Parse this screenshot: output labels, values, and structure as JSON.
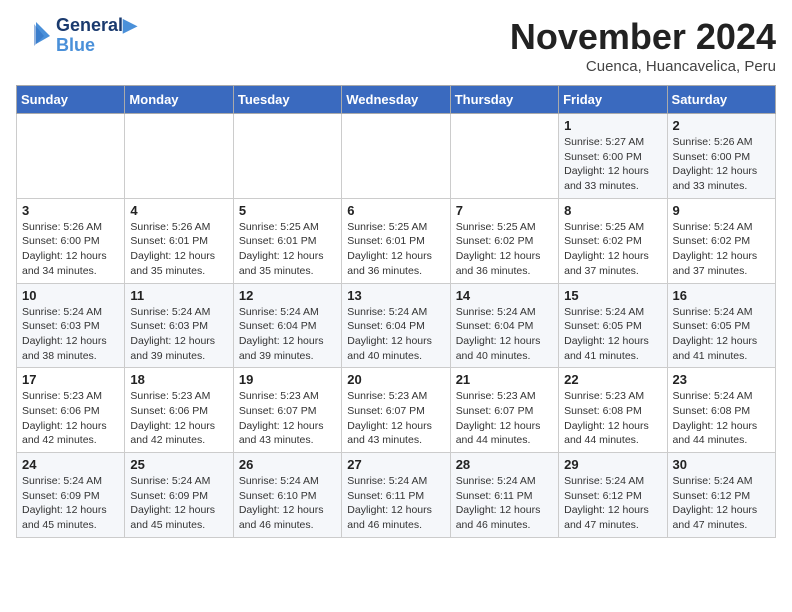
{
  "header": {
    "logo_line1": "General",
    "logo_line2": "Blue",
    "month": "November 2024",
    "location": "Cuenca, Huancavelica, Peru"
  },
  "weekdays": [
    "Sunday",
    "Monday",
    "Tuesday",
    "Wednesday",
    "Thursday",
    "Friday",
    "Saturday"
  ],
  "weeks": [
    [
      {
        "day": "",
        "info": ""
      },
      {
        "day": "",
        "info": ""
      },
      {
        "day": "",
        "info": ""
      },
      {
        "day": "",
        "info": ""
      },
      {
        "day": "",
        "info": ""
      },
      {
        "day": "1",
        "info": "Sunrise: 5:27 AM\nSunset: 6:00 PM\nDaylight: 12 hours and 33 minutes."
      },
      {
        "day": "2",
        "info": "Sunrise: 5:26 AM\nSunset: 6:00 PM\nDaylight: 12 hours and 33 minutes."
      }
    ],
    [
      {
        "day": "3",
        "info": "Sunrise: 5:26 AM\nSunset: 6:00 PM\nDaylight: 12 hours and 34 minutes."
      },
      {
        "day": "4",
        "info": "Sunrise: 5:26 AM\nSunset: 6:01 PM\nDaylight: 12 hours and 35 minutes."
      },
      {
        "day": "5",
        "info": "Sunrise: 5:25 AM\nSunset: 6:01 PM\nDaylight: 12 hours and 35 minutes."
      },
      {
        "day": "6",
        "info": "Sunrise: 5:25 AM\nSunset: 6:01 PM\nDaylight: 12 hours and 36 minutes."
      },
      {
        "day": "7",
        "info": "Sunrise: 5:25 AM\nSunset: 6:02 PM\nDaylight: 12 hours and 36 minutes."
      },
      {
        "day": "8",
        "info": "Sunrise: 5:25 AM\nSunset: 6:02 PM\nDaylight: 12 hours and 37 minutes."
      },
      {
        "day": "9",
        "info": "Sunrise: 5:24 AM\nSunset: 6:02 PM\nDaylight: 12 hours and 37 minutes."
      }
    ],
    [
      {
        "day": "10",
        "info": "Sunrise: 5:24 AM\nSunset: 6:03 PM\nDaylight: 12 hours and 38 minutes."
      },
      {
        "day": "11",
        "info": "Sunrise: 5:24 AM\nSunset: 6:03 PM\nDaylight: 12 hours and 39 minutes."
      },
      {
        "day": "12",
        "info": "Sunrise: 5:24 AM\nSunset: 6:04 PM\nDaylight: 12 hours and 39 minutes."
      },
      {
        "day": "13",
        "info": "Sunrise: 5:24 AM\nSunset: 6:04 PM\nDaylight: 12 hours and 40 minutes."
      },
      {
        "day": "14",
        "info": "Sunrise: 5:24 AM\nSunset: 6:04 PM\nDaylight: 12 hours and 40 minutes."
      },
      {
        "day": "15",
        "info": "Sunrise: 5:24 AM\nSunset: 6:05 PM\nDaylight: 12 hours and 41 minutes."
      },
      {
        "day": "16",
        "info": "Sunrise: 5:24 AM\nSunset: 6:05 PM\nDaylight: 12 hours and 41 minutes."
      }
    ],
    [
      {
        "day": "17",
        "info": "Sunrise: 5:23 AM\nSunset: 6:06 PM\nDaylight: 12 hours and 42 minutes."
      },
      {
        "day": "18",
        "info": "Sunrise: 5:23 AM\nSunset: 6:06 PM\nDaylight: 12 hours and 42 minutes."
      },
      {
        "day": "19",
        "info": "Sunrise: 5:23 AM\nSunset: 6:07 PM\nDaylight: 12 hours and 43 minutes."
      },
      {
        "day": "20",
        "info": "Sunrise: 5:23 AM\nSunset: 6:07 PM\nDaylight: 12 hours and 43 minutes."
      },
      {
        "day": "21",
        "info": "Sunrise: 5:23 AM\nSunset: 6:07 PM\nDaylight: 12 hours and 44 minutes."
      },
      {
        "day": "22",
        "info": "Sunrise: 5:23 AM\nSunset: 6:08 PM\nDaylight: 12 hours and 44 minutes."
      },
      {
        "day": "23",
        "info": "Sunrise: 5:24 AM\nSunset: 6:08 PM\nDaylight: 12 hours and 44 minutes."
      }
    ],
    [
      {
        "day": "24",
        "info": "Sunrise: 5:24 AM\nSunset: 6:09 PM\nDaylight: 12 hours and 45 minutes."
      },
      {
        "day": "25",
        "info": "Sunrise: 5:24 AM\nSunset: 6:09 PM\nDaylight: 12 hours and 45 minutes."
      },
      {
        "day": "26",
        "info": "Sunrise: 5:24 AM\nSunset: 6:10 PM\nDaylight: 12 hours and 46 minutes."
      },
      {
        "day": "27",
        "info": "Sunrise: 5:24 AM\nSunset: 6:11 PM\nDaylight: 12 hours and 46 minutes."
      },
      {
        "day": "28",
        "info": "Sunrise: 5:24 AM\nSunset: 6:11 PM\nDaylight: 12 hours and 46 minutes."
      },
      {
        "day": "29",
        "info": "Sunrise: 5:24 AM\nSunset: 6:12 PM\nDaylight: 12 hours and 47 minutes."
      },
      {
        "day": "30",
        "info": "Sunrise: 5:24 AM\nSunset: 6:12 PM\nDaylight: 12 hours and 47 minutes."
      }
    ]
  ]
}
